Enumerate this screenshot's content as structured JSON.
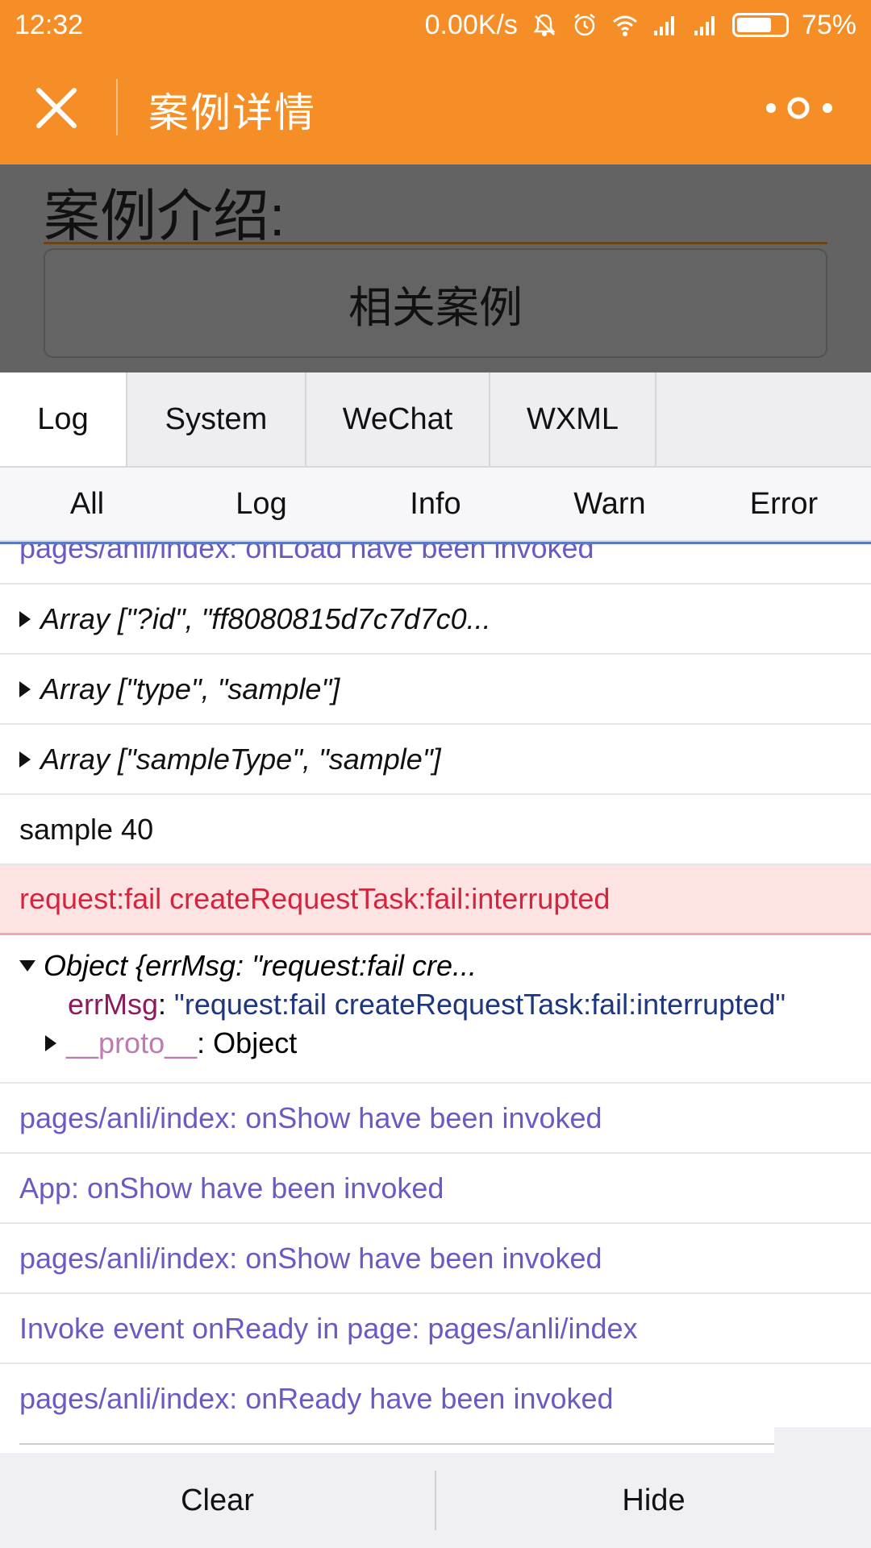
{
  "status_bar": {
    "time": "12:32",
    "net_speed": "0.00K/s",
    "battery": "75%",
    "battery_level": 0.75,
    "icons": [
      "bell-off-icon",
      "alarm-icon",
      "wifi-icon",
      "signal-icon",
      "signal-icon",
      "battery-icon"
    ]
  },
  "nav": {
    "title": "案例详情",
    "close_icon": "close-icon",
    "more_icon": "more-icon"
  },
  "page": {
    "heading": "案例介绍:",
    "related_button": "相关案例"
  },
  "console": {
    "tabs": [
      {
        "label": "Log",
        "active": true
      },
      {
        "label": "System",
        "active": false
      },
      {
        "label": "WeChat",
        "active": false
      },
      {
        "label": "WXML",
        "active": false
      }
    ],
    "filters": [
      "All",
      "Log",
      "Info",
      "Warn",
      "Error"
    ],
    "logs": {
      "partial_top": "pages/anli/index: onLoad have been invoked",
      "array1": "Array [\"?id\", \"ff8080815d7c7d7c0...",
      "array2": "Array [\"type\", \"sample\"]",
      "array3": "Array [\"sampleType\", \"sample\"]",
      "sample": "sample 40",
      "error": "request:fail createRequestTask:fail:interrupted",
      "object_header": "Object {errMsg: \"request:fail cre...",
      "errmsg_key": "errMsg",
      "colon": ":",
      "errmsg_value": "\"request:fail createRequestTask:fail:interrupted\"",
      "proto_key": "__proto__",
      "proto_value": "Object",
      "info1": "pages/anli/index: onShow have been invoked",
      "info2": "App: onShow have been invoked",
      "info3": "pages/anli/index: onShow have been invoked",
      "info4": "Invoke event onReady in page: pages/anli/index",
      "info5": "pages/anli/index: onReady have been invoked"
    },
    "buttons": {
      "clear": "Clear",
      "hide": "Hide"
    }
  },
  "colors": {
    "brand_orange": "#f68e27",
    "info_text": "#6a5bc4",
    "error_text": "#d5243d",
    "error_bg": "#fee3e3"
  }
}
